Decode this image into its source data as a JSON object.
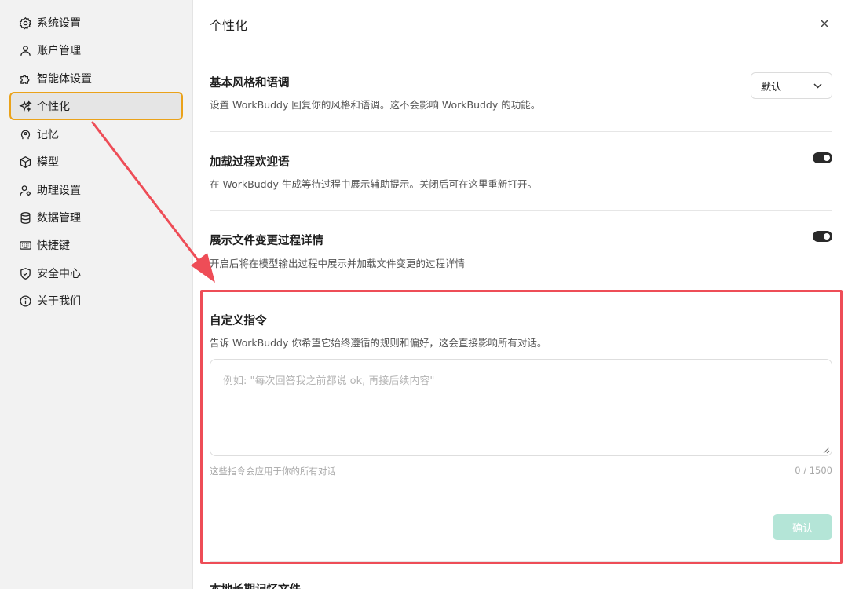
{
  "sidebar": {
    "items": [
      {
        "label": "系统设置",
        "icon": "gear-icon"
      },
      {
        "label": "账户管理",
        "icon": "user-icon"
      },
      {
        "label": "智能体设置",
        "icon": "puzzle-icon"
      },
      {
        "label": "个性化",
        "icon": "sparkle-icon",
        "active": true
      },
      {
        "label": "记忆",
        "icon": "brain-icon"
      },
      {
        "label": "模型",
        "icon": "cube-icon"
      },
      {
        "label": "助理设置",
        "icon": "user-gear-icon"
      },
      {
        "label": "数据管理",
        "icon": "database-icon"
      },
      {
        "label": "快捷键",
        "icon": "keyboard-icon"
      },
      {
        "label": "安全中心",
        "icon": "shield-icon"
      },
      {
        "label": "关于我们",
        "icon": "info-icon"
      }
    ]
  },
  "main": {
    "title": "个性化",
    "style_section": {
      "title": "基本风格和语调",
      "desc": "设置 WorkBuddy 回复你的风格和语调。这不会影响 WorkBuddy 的功能。",
      "select_value": "默认"
    },
    "loading_section": {
      "title": "加载过程欢迎语",
      "desc": "在 WorkBuddy 生成等待过程中展示辅助提示。关闭后可在这里重新打开。",
      "enabled": true
    },
    "file_section": {
      "title": "展示文件变更过程详情",
      "desc": "开启后将在模型输出过程中展示并加载文件变更的过程详情",
      "enabled": true
    },
    "custom_section": {
      "title": "自定义指令",
      "desc": "告诉 WorkBuddy 你希望它始终遵循的规则和偏好，这会直接影响所有对话。",
      "placeholder": "例如: \"每次回答我之前都说 ok, 再接后续内容\"",
      "hint": "这些指令会应用于你的所有对话",
      "counter": "0 / 1500",
      "confirm_label": "确认"
    },
    "next_section_title": "本地长期记忆文件"
  },
  "colors": {
    "highlight": "#ee4d57",
    "active_border": "#eaa21a",
    "confirm_bg": "#b4e5d7"
  }
}
